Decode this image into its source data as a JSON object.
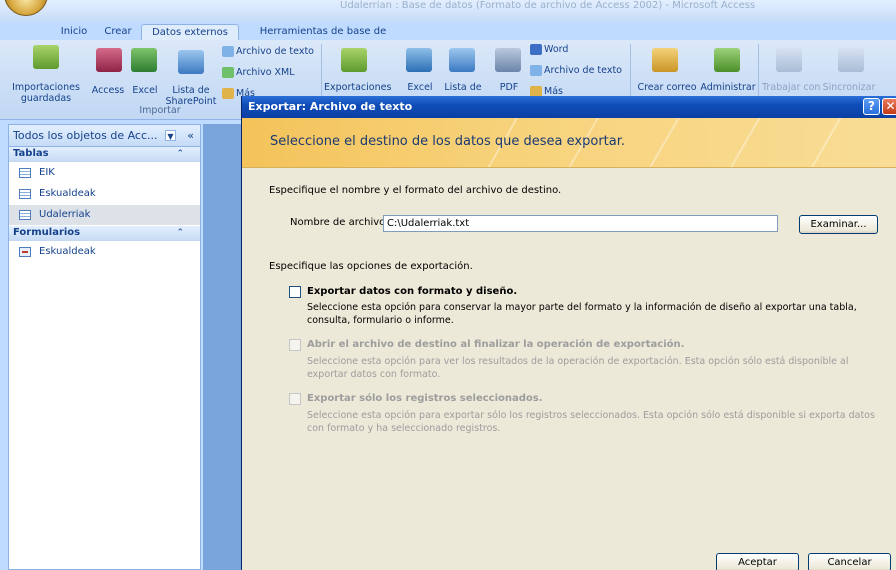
{
  "window": {
    "title": "Udalerrian : Base de datos (Formato de archivo de Access 2002) - Microsoft Access"
  },
  "tabs": [
    "Inicio",
    "Crear",
    "Datos externos",
    "Herramientas de base de datos"
  ],
  "active_tab": "Datos externos",
  "ribbon": {
    "import_group": {
      "label": "Importar",
      "saved": "Importaciones guardadas",
      "access": "Access",
      "excel": "Excel",
      "sharepoint": "Lista de SharePoint",
      "small": [
        "Archivo de texto",
        "Archivo XML",
        "Más"
      ]
    },
    "export_group": {
      "saved": "Exportaciones",
      "excel": "Excel",
      "sharepoint": "Lista de",
      "pdf": "PDF",
      "small": [
        "Word",
        "Archivo de texto",
        "Más"
      ]
    },
    "collect_group": {
      "create_mail": "Crear correo",
      "manage": "Administrar"
    },
    "offline_group": {
      "work_offline": "Trabajar con",
      "sync": "Sincronizar"
    }
  },
  "nav": {
    "header": "Todos los objetos de Acc...",
    "groups": [
      {
        "label": "Tablas",
        "items": [
          "EIK",
          "Eskualdeak",
          "Udalerriak"
        ]
      },
      {
        "label": "Formularios",
        "items": [
          "Eskualdeak"
        ]
      }
    ],
    "selected": "Udalerriak"
  },
  "dialog": {
    "title": "Exportar: Archivo de texto",
    "banner": "Seleccione el destino de los datos que desea exportar.",
    "spec_file": "Especifique el nombre y el formato del archivo de destino.",
    "file_label": "Nombre de archivo:",
    "file_value": "C:\\Udalerriak.txt",
    "browse": "Examinar...",
    "spec_options": "Especifique las opciones de exportación.",
    "options": [
      {
        "label": "Exportar datos con formato y diseño.",
        "desc": "Seleccione esta opción para conservar la mayor parte del formato y la información de diseño al exportar una tabla, consulta, formulario o informe.",
        "enabled": true,
        "checked": false
      },
      {
        "label": "Abrir el archivo de destino al finalizar la operación de exportación.",
        "desc": "Seleccione esta opción para ver los resultados de la operación de exportación. Esta opción sólo está disponible al exportar datos con formato.",
        "enabled": false,
        "checked": false
      },
      {
        "label": "Exportar sólo los registros seleccionados.",
        "desc": "Seleccione esta opción para exportar sólo los registros seleccionados. Esta opción sólo está disponible si exporta datos con formato y ha seleccionado registros.",
        "enabled": false,
        "checked": false
      }
    ],
    "ok": "Aceptar",
    "cancel": "Cancelar"
  }
}
